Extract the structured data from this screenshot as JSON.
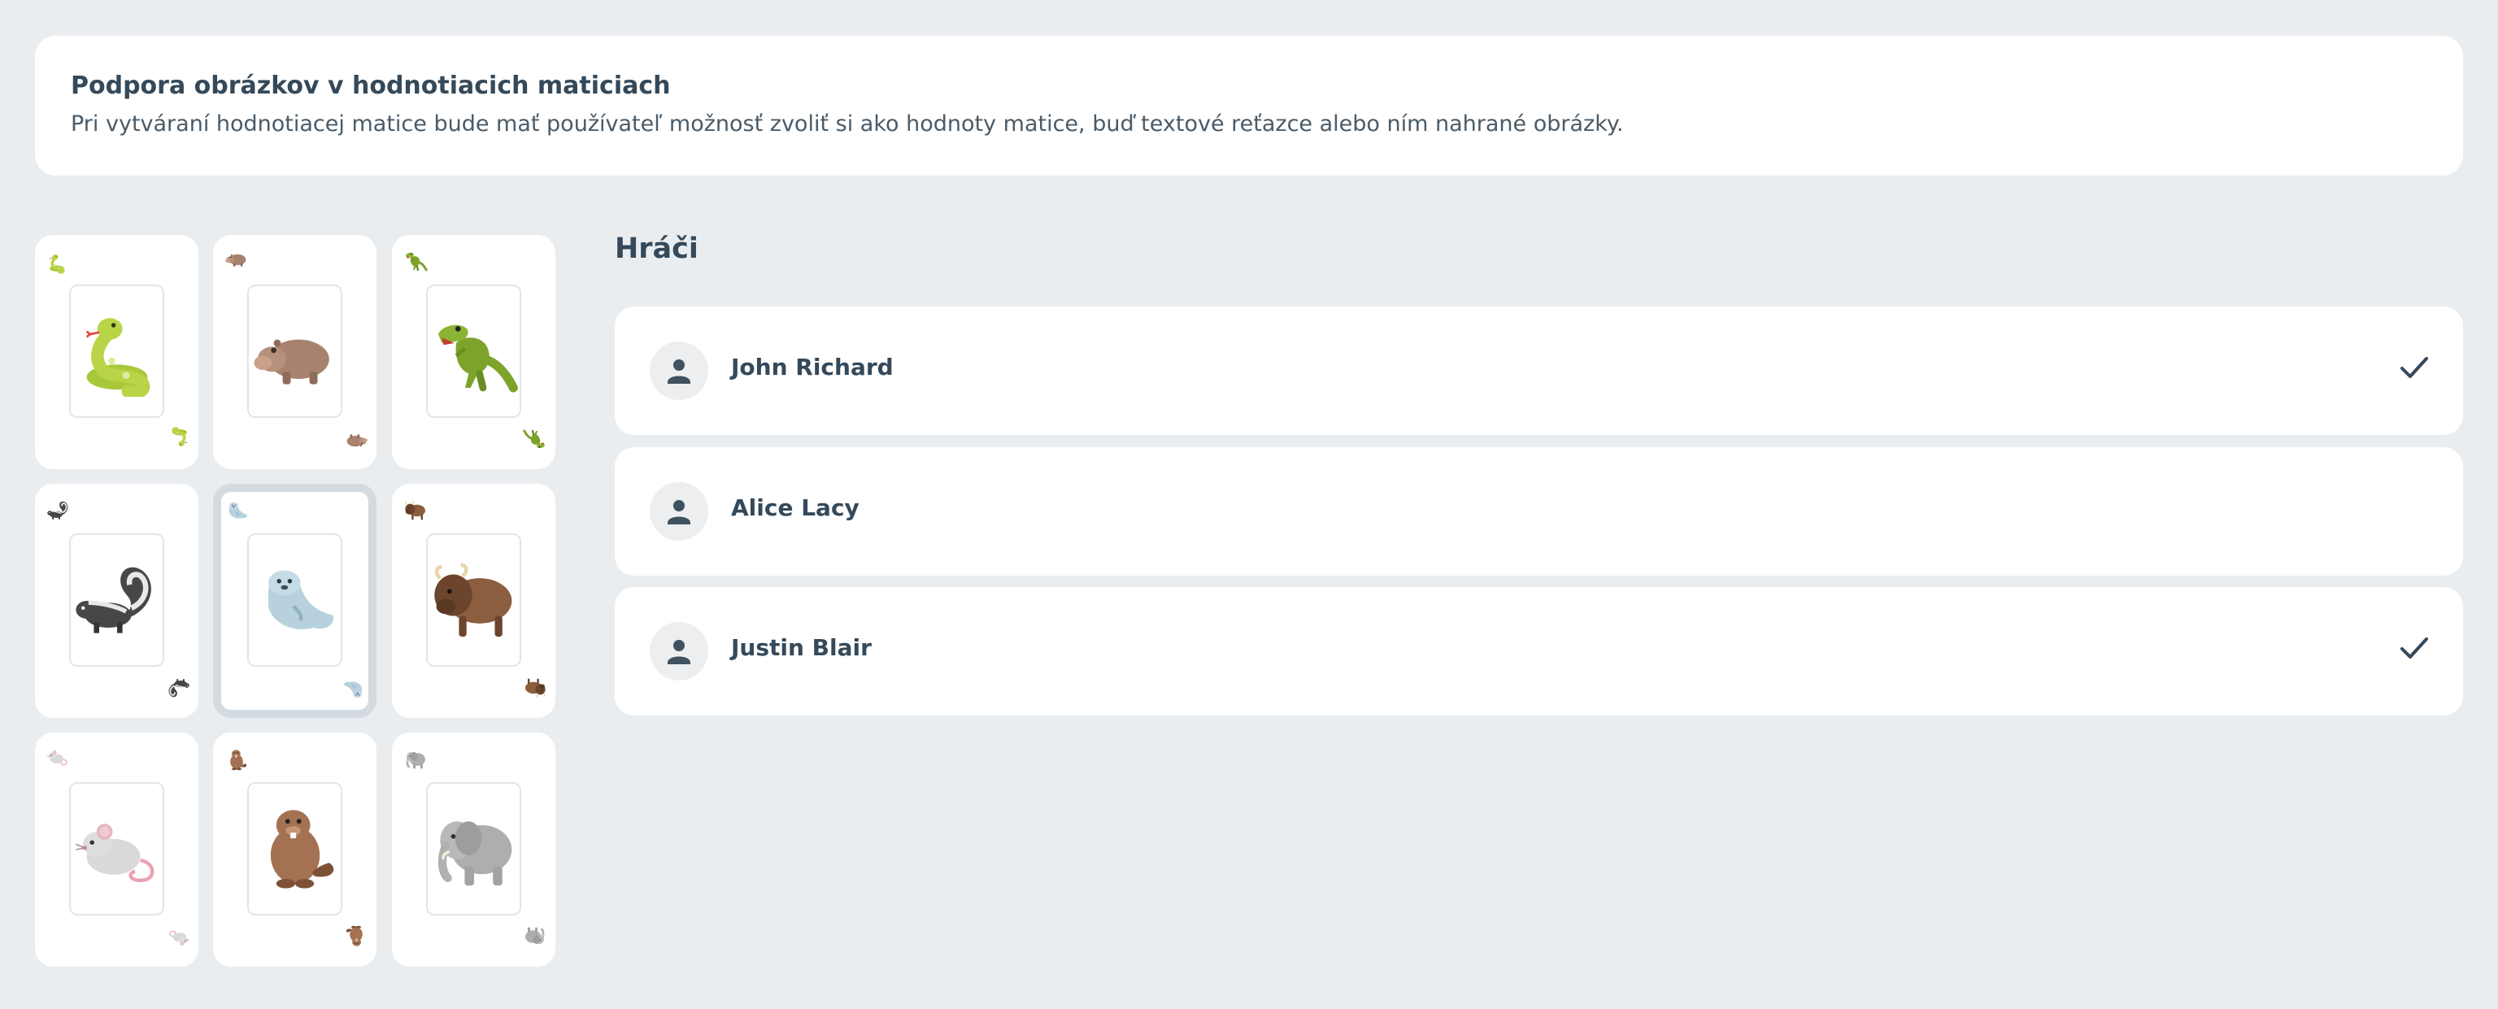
{
  "banner": {
    "title": "Podpora obrázkov v hodnotiacich maticiach",
    "description": "Pri vytváraní hodnotiacej matice bude mať používateľ možnosť zvoliť si ako hodnoty matice, buď textové reťazce alebo ním nahrané obrázky."
  },
  "cards": [
    {
      "icon": "snake-icon",
      "selected": false
    },
    {
      "icon": "hippo-icon",
      "selected": false
    },
    {
      "icon": "t-rex-icon",
      "selected": false
    },
    {
      "icon": "skunk-icon",
      "selected": false
    },
    {
      "icon": "seal-icon",
      "selected": true
    },
    {
      "icon": "bison-icon",
      "selected": false
    },
    {
      "icon": "mouse-icon",
      "selected": false
    },
    {
      "icon": "beaver-icon",
      "selected": false
    },
    {
      "icon": "elephant-icon",
      "selected": false
    }
  ],
  "players": {
    "title": "Hráči",
    "items": [
      {
        "name": "John Richard",
        "checked": true
      },
      {
        "name": "Alice Lacy",
        "checked": false
      },
      {
        "name": "Justin Blair",
        "checked": true
      }
    ]
  },
  "colors": {
    "background": "#eaedf0",
    "card": "#ffffff",
    "text": "#34495a",
    "selected_border": "#d3dbe1"
  }
}
